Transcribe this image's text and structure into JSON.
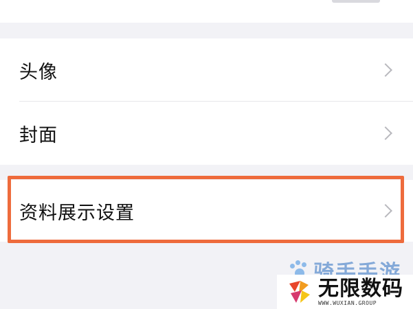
{
  "rows": [
    {
      "label": "头像"
    },
    {
      "label": "封面"
    },
    {
      "label": "资料展示设置"
    }
  ],
  "watermarks": {
    "top_text": "骑手手游",
    "brand_text": "无限数码",
    "brand_url": "WWW.WUXIAN.GROUP"
  },
  "colors": {
    "highlight": "#ee6b3c",
    "background": "#f2f2f6",
    "row_bg": "#ffffff",
    "chevron": "#b8b8bd"
  },
  "icons": {
    "row_chevron": "chevron-right-icon",
    "wm_paw": "paw-icon",
    "wm_logo": "wuxian-logo-icon"
  }
}
